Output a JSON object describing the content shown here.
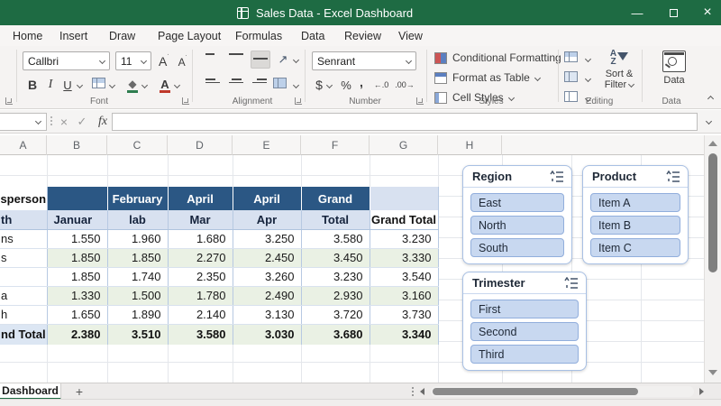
{
  "window": {
    "title": "Sales Data - Excel Dashboard",
    "icons": {
      "minimize": "—",
      "close": "×"
    }
  },
  "tabs": [
    "Home",
    "Insert",
    "Draw",
    "Page Layout",
    "Formulas",
    "Data",
    "Review",
    "View"
  ],
  "ribbon": {
    "font": {
      "name": "Callbri",
      "size": "11",
      "group_label": "Font",
      "bold": "B",
      "italic": "I",
      "underline": "U",
      "grow": "A",
      "shrink": "A",
      "color_letter": "A"
    },
    "alignment": {
      "group_label": "Alignment",
      "orientation_glyph": "↗"
    },
    "number": {
      "format": "Senrant",
      "group_label": "Number",
      "dollar": "$",
      "percent": "%",
      "comma": ",",
      "inc_decimal": "←.0",
      "dec_decimal": ".00→"
    },
    "styles": {
      "group_label": "Styles",
      "items": [
        "Conditional Formatting",
        "Format as Table",
        "Cell Styles"
      ]
    },
    "editing": {
      "group_label": "Editing",
      "sort_line1": "Sort &",
      "sort_line2": "Filter",
      "az_a": "A",
      "az_z": "Z"
    },
    "data": {
      "group_label": "Data",
      "button_label": "Data"
    }
  },
  "formula_bar": {
    "value": "",
    "fx": "fx",
    "cancel": "×",
    "enter": "✓"
  },
  "grid": {
    "columns": [
      "A",
      "B",
      "C",
      "D",
      "E",
      "F",
      "G",
      "H"
    ]
  },
  "pivot": {
    "header_row1": {
      "a": "sperson",
      "c1": "",
      "c2": "February",
      "c3": "April",
      "c4": "April",
      "c5": "Grand",
      "g": ""
    },
    "header_row2": {
      "a": "th",
      "c1": "Januar",
      "c2": "lab",
      "c3": "Mar",
      "c4": "Apr",
      "c5": "Total",
      "g": "Grand Total"
    },
    "rows": [
      {
        "label": "ns",
        "values": [
          "1.550",
          "1.960",
          "1.680",
          "3.250",
          "3.580",
          "3.230"
        ]
      },
      {
        "label": "s",
        "values": [
          "1.850",
          "1.850",
          "2.270",
          "2.450",
          "3.450",
          "3.330"
        ]
      },
      {
        "label": "",
        "values": [
          "1.850",
          "1.740",
          "2.350",
          "3.260",
          "3.230",
          "3.540"
        ]
      },
      {
        "label": "a",
        "values": [
          "1.330",
          "1.500",
          "1.780",
          "2.490",
          "2.930",
          "3.160"
        ]
      },
      {
        "label": "h",
        "values": [
          "1.650",
          "1.890",
          "2.140",
          "3.130",
          "3.720",
          "3.730"
        ]
      }
    ],
    "grand_total": {
      "label": "nd Total",
      "values": [
        "2.380",
        "3.510",
        "3.580",
        "3.030",
        "3.680",
        "3.340"
      ]
    }
  },
  "slicers": [
    {
      "title": "Region",
      "items": [
        "East",
        "North",
        "South"
      ]
    },
    {
      "title": "Product",
      "items": [
        "Item A",
        "Item B",
        "Item C"
      ]
    },
    {
      "title": "Trimester",
      "items": [
        "First",
        "Second",
        "Third"
      ]
    }
  ],
  "sheet_bar": {
    "active_tab": "Dashboard",
    "new_sheet": "+"
  },
  "colors": {
    "titlebar_green": "#1E6B43",
    "pivot_header_blue": "#2B5784",
    "pivot_subheader_blue": "#D8E1F0",
    "row_green": "#EAF1E4",
    "slicer_item_blue": "#C8D8F0",
    "fill_color_green": "#2E7D4F",
    "font_color_red": "#C0392B"
  }
}
